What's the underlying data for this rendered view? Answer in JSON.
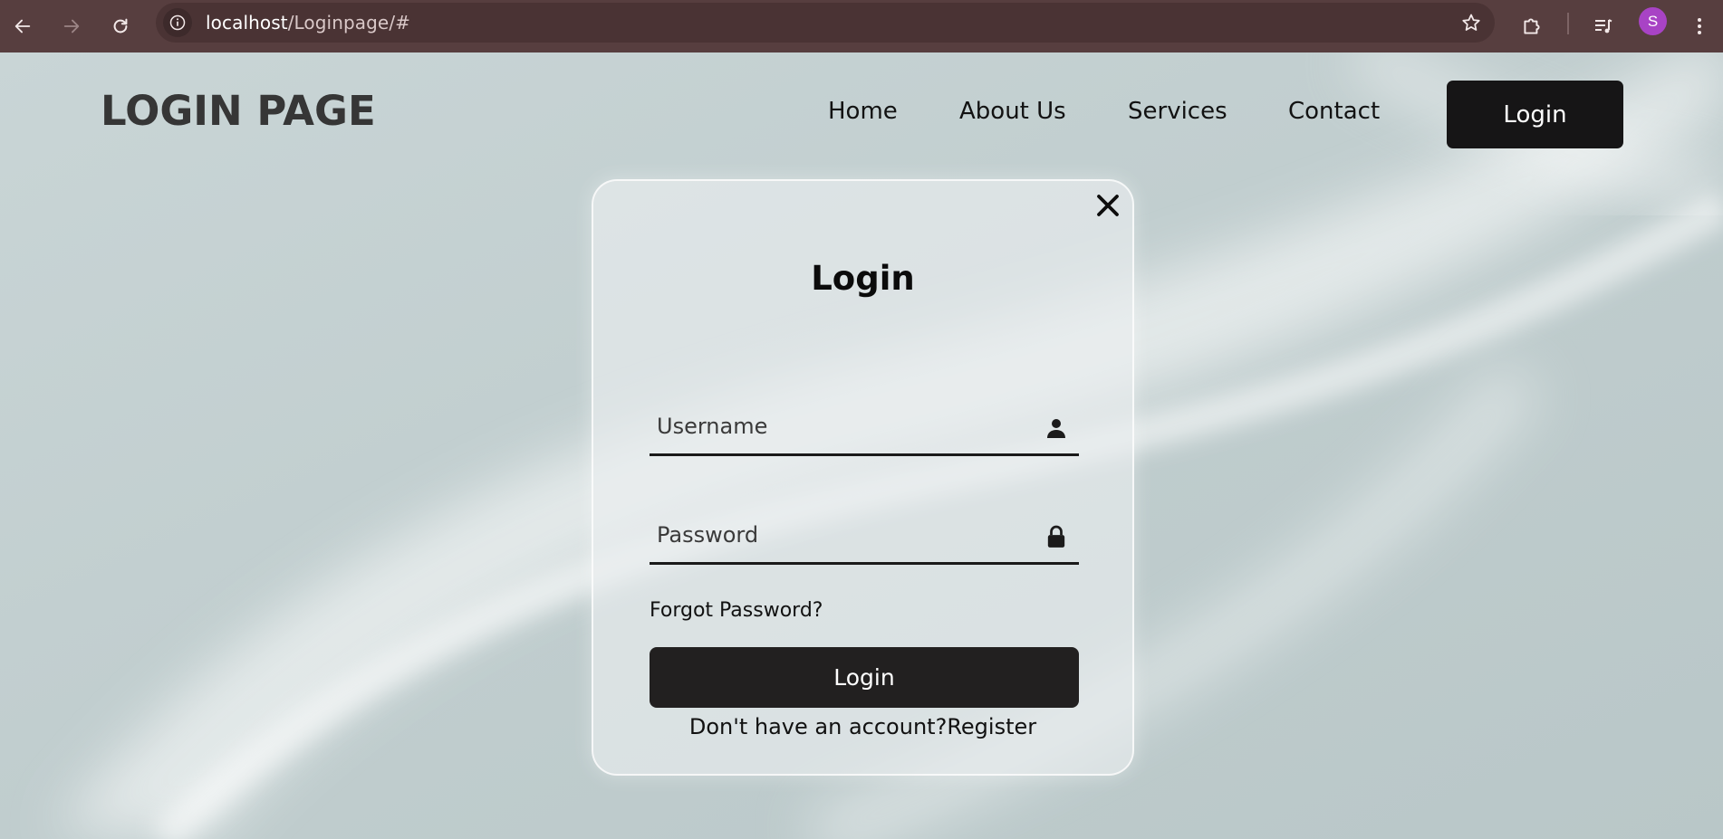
{
  "browser": {
    "url_host": "localhost",
    "url_path": "/Loginpage/#",
    "profile_initial": "S",
    "icons": {
      "back": "arrow-left-icon",
      "forward": "arrow-right-icon",
      "reload": "reload-icon",
      "site_info": "info-icon",
      "bookmark": "star-icon",
      "extensions": "puzzle-icon",
      "media": "media-queue-icon",
      "menu": "more-vertical-icon"
    }
  },
  "header": {
    "logo": "LOGIN PAGE",
    "nav": {
      "home": "Home",
      "about": "About Us",
      "services": "Services",
      "contact": "Contact"
    },
    "login_button": "Login"
  },
  "login_form": {
    "title": "Login",
    "username": {
      "placeholder": "Username",
      "value": "",
      "icon": "user-icon"
    },
    "password": {
      "placeholder": "Password",
      "value": "",
      "icon": "lock-icon"
    },
    "forgot_password": "Forgot Password?",
    "submit_label": "Login",
    "register_prompt": "Don't have an account?",
    "register_link": "Register",
    "close_icon": "close-icon"
  },
  "colors": {
    "chrome_bar": "#573e3f",
    "page_background": "#c3d0d1",
    "button_dark": "#161516",
    "profile_avatar": "#a843c5"
  }
}
